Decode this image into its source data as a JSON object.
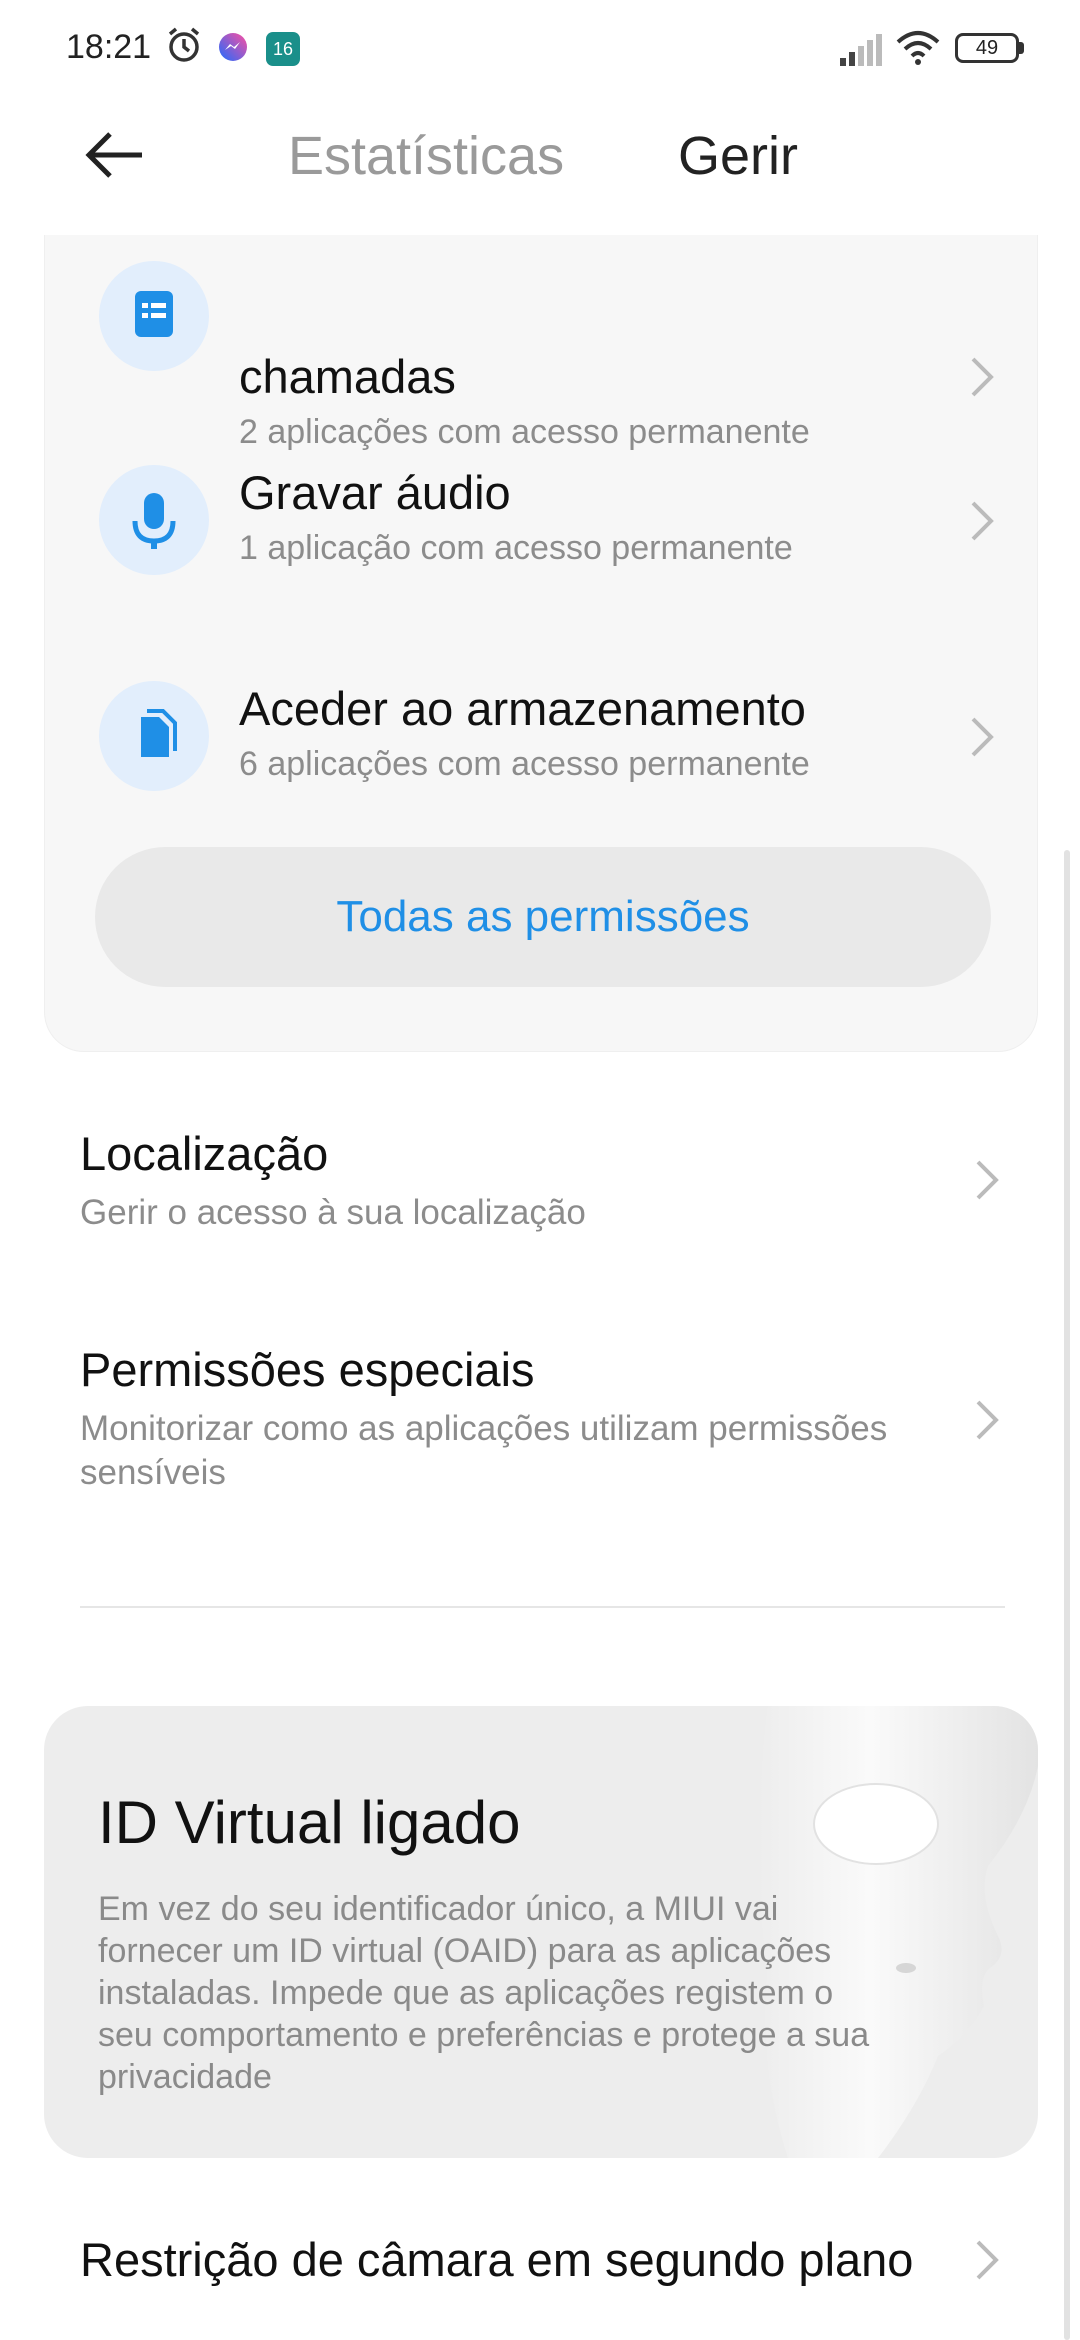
{
  "status_bar": {
    "time": "18:21",
    "battery": "49",
    "notif_badge": "16"
  },
  "header": {
    "tab_stats": "Estatísticas",
    "tab_manage": "Gerir"
  },
  "permissions": [
    {
      "title": "chamadas",
      "subtitle": "2 aplicações com acesso permanente",
      "icon": "call-log-icon"
    },
    {
      "title": "Gravar áudio",
      "subtitle": "1 aplicação com acesso permanente",
      "icon": "microphone-icon"
    },
    {
      "title": "Aceder ao armazenamento",
      "subtitle": "6 aplicações com acesso permanente",
      "icon": "storage-icon"
    }
  ],
  "all_permissions_label": "Todas as permissões",
  "location": {
    "title": "Localização",
    "subtitle": "Gerir o acesso à sua localização"
  },
  "special": {
    "title": "Permissões especiais",
    "subtitle": "Monitorizar como as aplicações utilizam permissões sensíveis"
  },
  "virtual_id": {
    "title": "ID Virtual ligado",
    "text": "Em vez do seu identificador único, a MIUI vai fornecer um ID virtual (OAID) para as aplicações instaladas. Impede que as aplicações registem o seu comportamento e preferências e protege a sua privacidade"
  },
  "camera_restriction": "Restrição de câmara em segundo plano",
  "colors": {
    "accent": "#1f8fe6",
    "icon_bg": "#e2eefc"
  }
}
